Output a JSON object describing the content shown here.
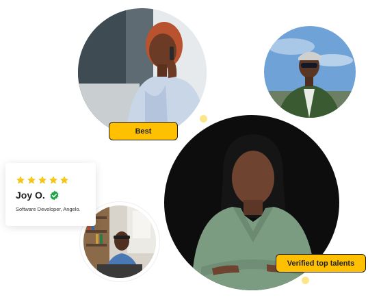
{
  "badges": {
    "best": "Best",
    "verified_talents": "Verified top talents"
  },
  "review_card": {
    "rating": 5,
    "rating_max": 5,
    "name": "Joy O.",
    "role": "Software Developer, Angelo."
  },
  "colors": {
    "badge_yellow": "#fec000",
    "badge_border": "#1f1f1f",
    "star_yellow": "#f5c518",
    "verified_green": "#22a447",
    "dot_yellow": "#fde68a"
  },
  "icons": {
    "star": "star-icon",
    "verified": "verified-check-icon"
  }
}
